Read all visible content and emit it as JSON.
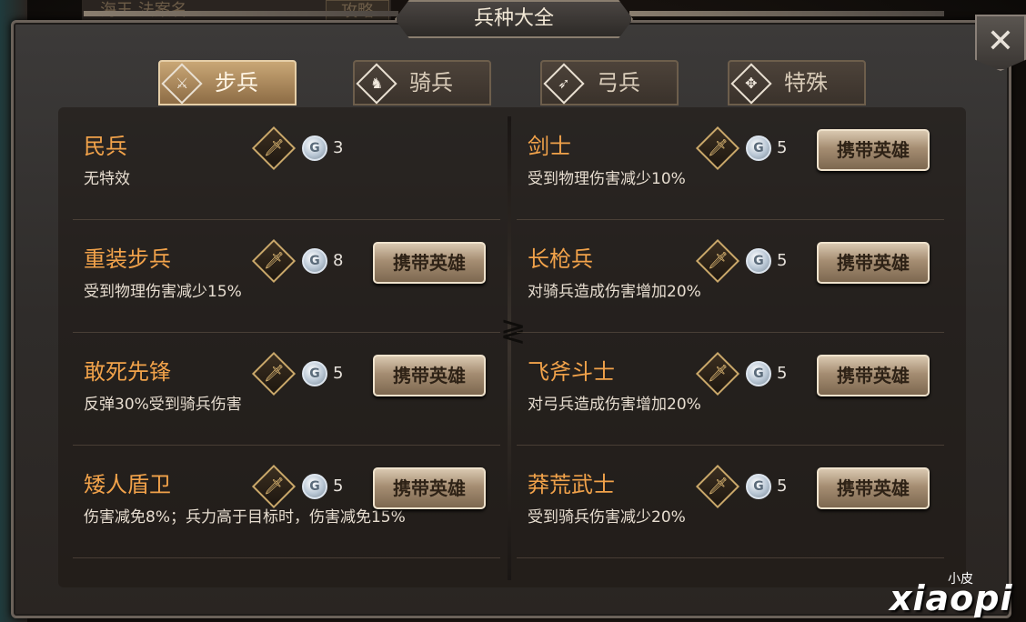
{
  "header": {
    "title": "兵种大全",
    "close_symbol": "✕",
    "background_hint": "海王 法案名",
    "background_tab_hint": "攻略"
  },
  "tabs": [
    {
      "label": "步兵",
      "icon": "sword-icon",
      "glyph": "⚔",
      "active": true
    },
    {
      "label": "骑兵",
      "icon": "horse-icon",
      "glyph": "♞",
      "active": false
    },
    {
      "label": "弓兵",
      "icon": "bow-icon",
      "glyph": "➶",
      "active": false
    },
    {
      "label": "特殊",
      "icon": "cross-dots-icon",
      "glyph": "✥",
      "active": false
    }
  ],
  "units_left": [
    {
      "name": "民兵",
      "desc": "无特效",
      "cost": "3",
      "button": ""
    },
    {
      "name": "重装步兵",
      "desc": "受到物理伤害减少15%",
      "cost": "8",
      "button": "携带英雄"
    },
    {
      "name": "敢死先锋",
      "desc": "反弹30%受到骑兵伤害",
      "cost": "5",
      "button": "携带英雄"
    },
    {
      "name": "矮人盾卫",
      "desc": "伤害减免8%；兵力高于目标时，伤害减免15%",
      "cost": "5",
      "button": "携带英雄"
    }
  ],
  "units_right": [
    {
      "name": "剑士",
      "desc": "受到物理伤害减少10%",
      "cost": "5",
      "button": "携带英雄"
    },
    {
      "name": "长枪兵",
      "desc": "对骑兵造成伤害增加20%",
      "cost": "5",
      "button": "携带英雄"
    },
    {
      "name": "飞斧斗士",
      "desc": "对弓兵造成伤害增加20%",
      "cost": "5",
      "button": "携带英雄"
    },
    {
      "name": "莽荒武士",
      "desc": "受到骑兵伤害减少20%",
      "cost": "5",
      "button": "携带英雄"
    }
  ],
  "icons": {
    "unit_type_glyph": "🗡",
    "coin_glyph": "G"
  },
  "watermark": {
    "small": "小皮",
    "big": "xiaopi"
  },
  "colors": {
    "unit_name": "#f1a24a",
    "active_tab": "#c9a776",
    "button": "#a58d72"
  }
}
